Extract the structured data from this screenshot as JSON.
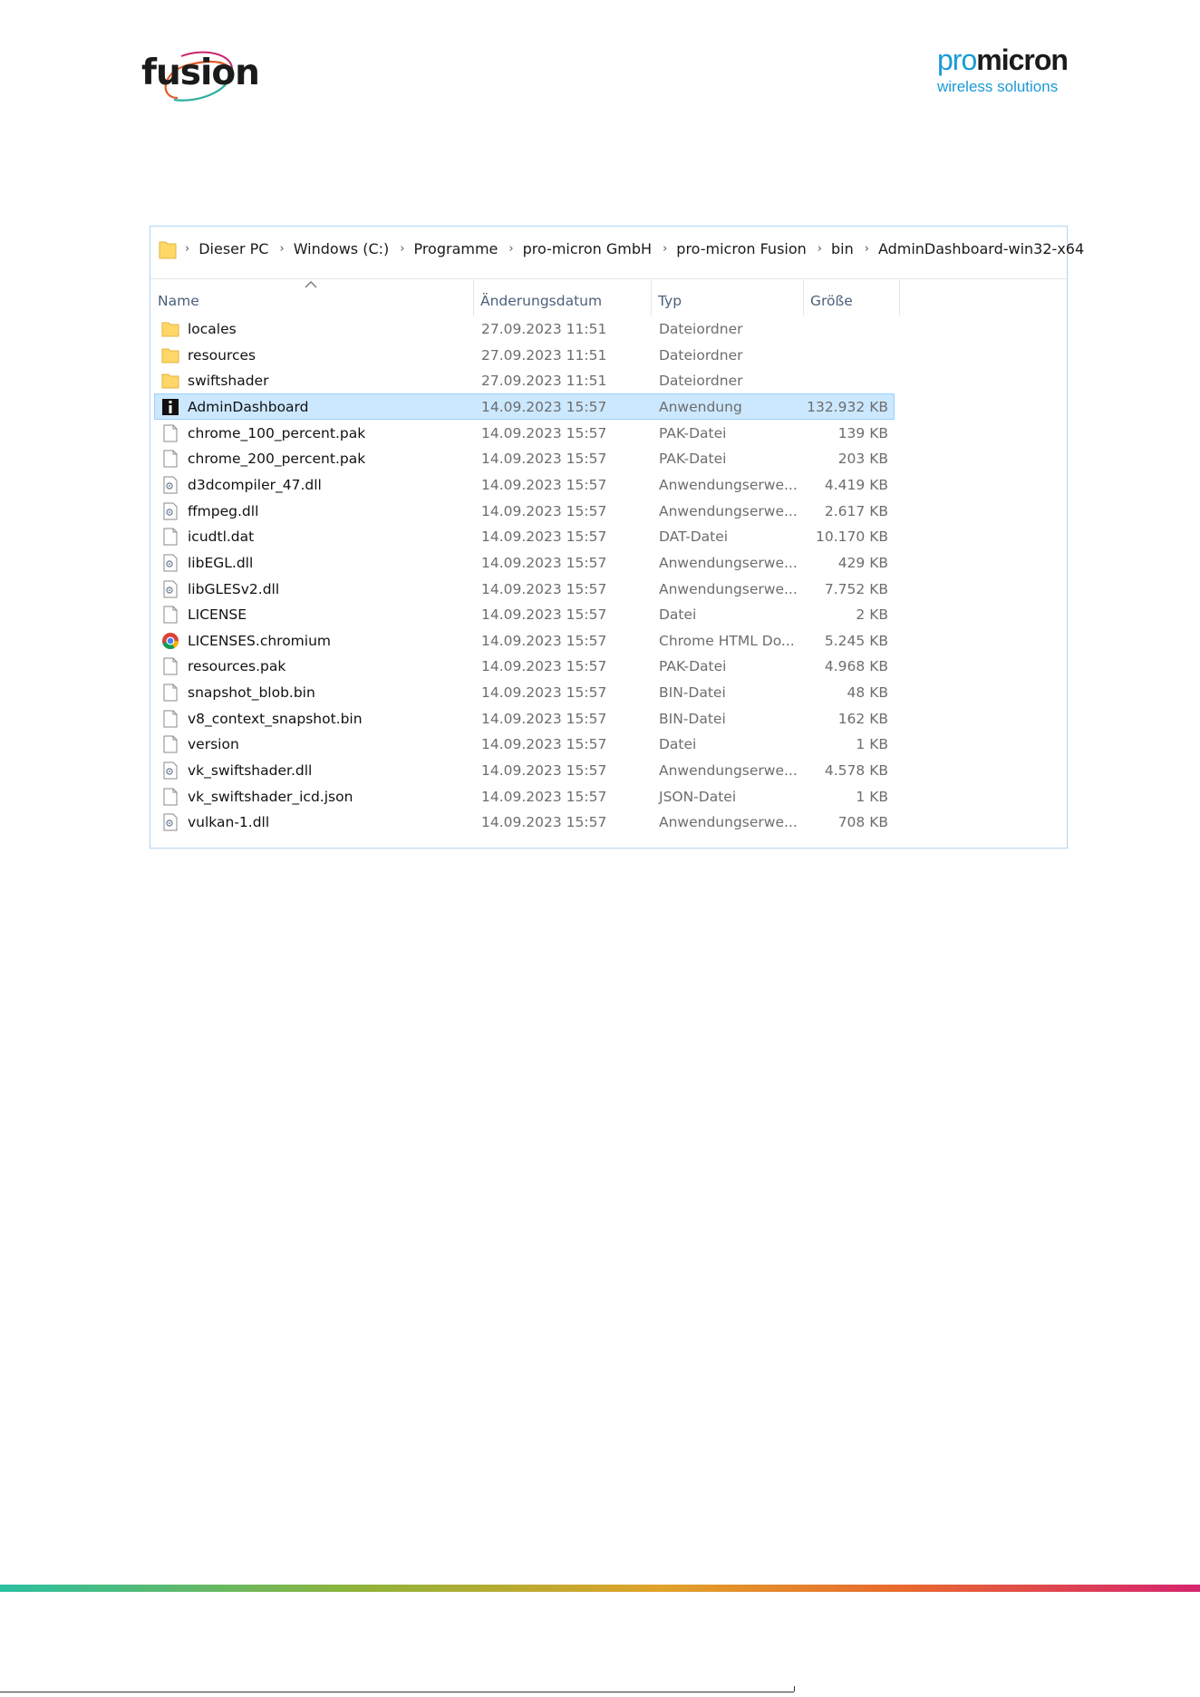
{
  "header": {
    "left_logo": "fusion",
    "right_logo_pro": "pro",
    "right_logo_micron": "micron",
    "right_logo_sub": "wireless solutions"
  },
  "explorer": {
    "breadcrumb": [
      "Dieser PC",
      "Windows (C:)",
      "Programme",
      "pro-micron GmbH",
      "pro-micron Fusion",
      "bin",
      "AdminDashboard-win32-x64"
    ],
    "columns": {
      "name": "Name",
      "date": "Änderungsdatum",
      "type": "Typ",
      "size": "Größe"
    },
    "files": [
      {
        "name": "locales",
        "date": "27.09.2023 11:51",
        "type": "Dateiordner",
        "size": "",
        "icon": "folder-icon"
      },
      {
        "name": "resources",
        "date": "27.09.2023 11:51",
        "type": "Dateiordner",
        "size": "",
        "icon": "folder-icon"
      },
      {
        "name": "swiftshader",
        "date": "27.09.2023 11:51",
        "type": "Dateiordner",
        "size": "",
        "icon": "folder-icon"
      },
      {
        "name": "AdminDashboard",
        "date": "14.09.2023 15:57",
        "type": "Anwendung",
        "size": "132.932 KB",
        "icon": "app-icon",
        "selected": true
      },
      {
        "name": "chrome_100_percent.pak",
        "date": "14.09.2023 15:57",
        "type": "PAK-Datei",
        "size": "139 KB",
        "icon": "file-icon"
      },
      {
        "name": "chrome_200_percent.pak",
        "date": "14.09.2023 15:57",
        "type": "PAK-Datei",
        "size": "203 KB",
        "icon": "file-icon"
      },
      {
        "name": "d3dcompiler_47.dll",
        "date": "14.09.2023 15:57",
        "type": "Anwendungserwe...",
        "size": "4.419 KB",
        "icon": "dll-icon"
      },
      {
        "name": "ffmpeg.dll",
        "date": "14.09.2023 15:57",
        "type": "Anwendungserwe...",
        "size": "2.617 KB",
        "icon": "dll-icon"
      },
      {
        "name": "icudtl.dat",
        "date": "14.09.2023 15:57",
        "type": "DAT-Datei",
        "size": "10.170 KB",
        "icon": "file-icon"
      },
      {
        "name": "libEGL.dll",
        "date": "14.09.2023 15:57",
        "type": "Anwendungserwe...",
        "size": "429 KB",
        "icon": "dll-icon"
      },
      {
        "name": "libGLESv2.dll",
        "date": "14.09.2023 15:57",
        "type": "Anwendungserwe...",
        "size": "7.752 KB",
        "icon": "dll-icon"
      },
      {
        "name": "LICENSE",
        "date": "14.09.2023 15:57",
        "type": "Datei",
        "size": "2 KB",
        "icon": "file-icon"
      },
      {
        "name": "LICENSES.chromium",
        "date": "14.09.2023 15:57",
        "type": "Chrome HTML Do...",
        "size": "5.245 KB",
        "icon": "chrome-icon"
      },
      {
        "name": "resources.pak",
        "date": "14.09.2023 15:57",
        "type": "PAK-Datei",
        "size": "4.968 KB",
        "icon": "file-icon"
      },
      {
        "name": "snapshot_blob.bin",
        "date": "14.09.2023 15:57",
        "type": "BIN-Datei",
        "size": "48 KB",
        "icon": "file-icon"
      },
      {
        "name": "v8_context_snapshot.bin",
        "date": "14.09.2023 15:57",
        "type": "BIN-Datei",
        "size": "162 KB",
        "icon": "file-icon"
      },
      {
        "name": "version",
        "date": "14.09.2023 15:57",
        "type": "Datei",
        "size": "1 KB",
        "icon": "file-icon"
      },
      {
        "name": "vk_swiftshader.dll",
        "date": "14.09.2023 15:57",
        "type": "Anwendungserwe...",
        "size": "4.578 KB",
        "icon": "dll-icon"
      },
      {
        "name": "vk_swiftshader_icd.json",
        "date": "14.09.2023 15:57",
        "type": "JSON-Datei",
        "size": "1 KB",
        "icon": "file-icon"
      },
      {
        "name": "vulkan-1.dll",
        "date": "14.09.2023 15:57",
        "type": "Anwendungserwe...",
        "size": "708 KB",
        "icon": "dll-icon"
      }
    ]
  },
  "colors": {
    "folder": "#ffd766",
    "selected_bg": "#cce8ff",
    "header_text": "#4c607a",
    "pro_blue": "#1a9ad6"
  }
}
